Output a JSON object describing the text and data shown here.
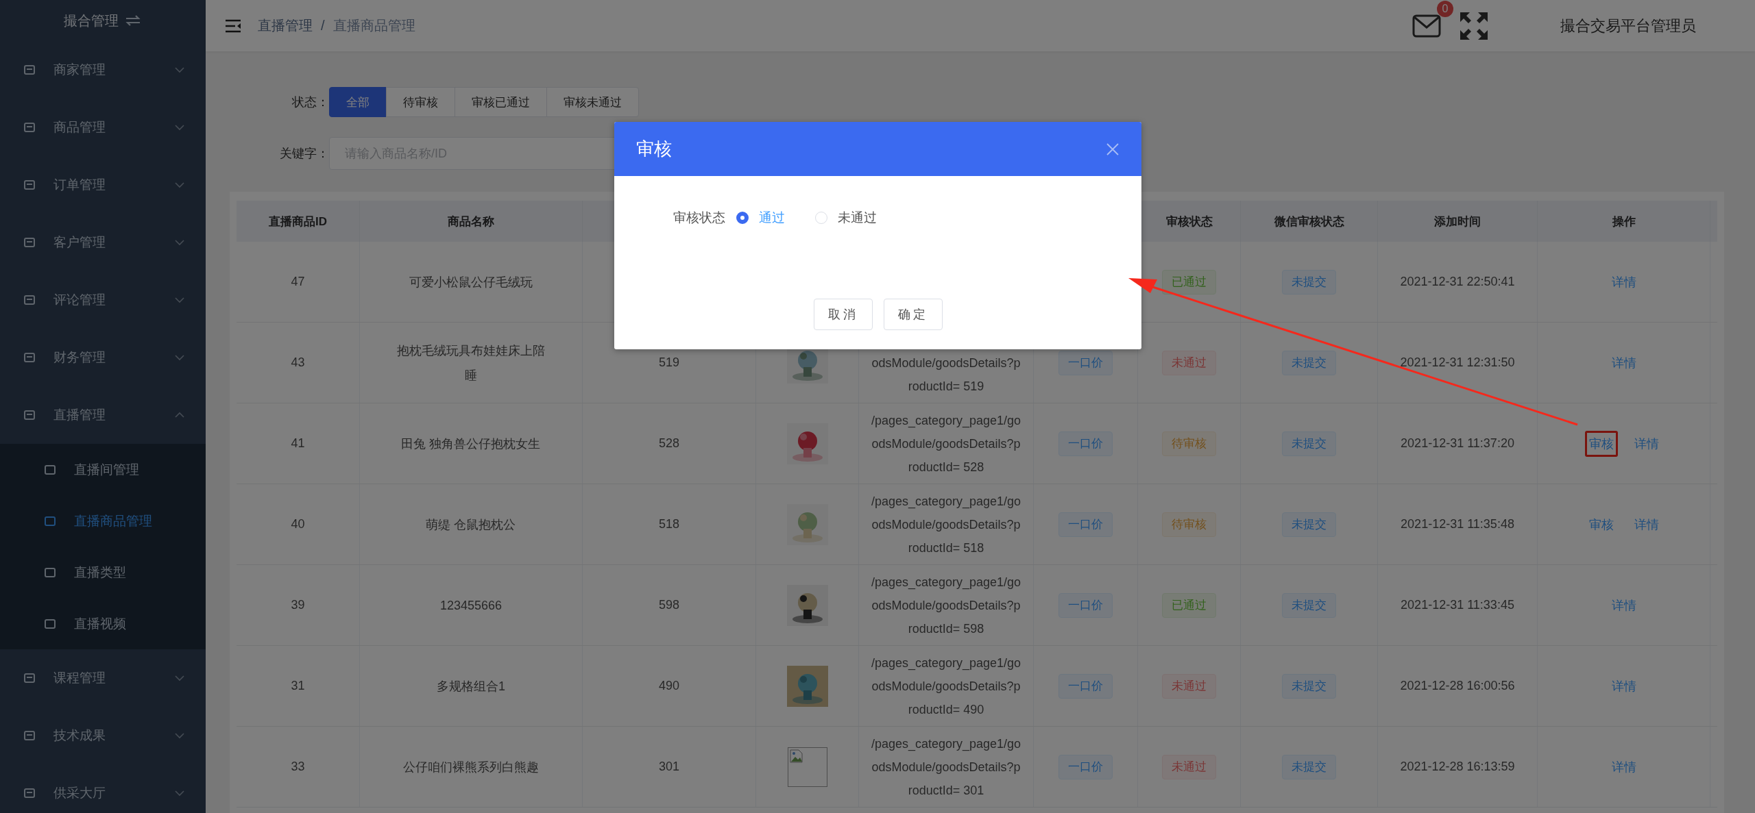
{
  "sidebar": {
    "title": "撮合管理",
    "menu": [
      {
        "label": "商家管理",
        "expanded": false
      },
      {
        "label": "商品管理",
        "expanded": false
      },
      {
        "label": "订单管理",
        "expanded": false
      },
      {
        "label": "客户管理",
        "expanded": false
      },
      {
        "label": "评论管理",
        "expanded": false
      },
      {
        "label": "财务管理",
        "expanded": false
      },
      {
        "label": "直播管理",
        "expanded": true,
        "children": [
          {
            "label": "直播间管理",
            "selected": false
          },
          {
            "label": "直播商品管理",
            "selected": true
          },
          {
            "label": "直播类型",
            "selected": false
          },
          {
            "label": "直播视频",
            "selected": false
          }
        ]
      },
      {
        "label": "课程管理",
        "expanded": false
      },
      {
        "label": "技术成果",
        "expanded": false
      },
      {
        "label": "供采大厅",
        "expanded": false
      }
    ]
  },
  "header": {
    "breadcrumb": [
      "直播管理",
      "直播商品管理"
    ],
    "breadcrumb_separator": "/",
    "mail_badge": "0",
    "user": "撮合交易平台管理员"
  },
  "filters": {
    "status_label": "状态：",
    "status_options": [
      {
        "label": "全部",
        "selected": true
      },
      {
        "label": "待审核",
        "selected": false
      },
      {
        "label": "审核已通过",
        "selected": false
      },
      {
        "label": "审核未通过",
        "selected": false
      }
    ],
    "keyword_label": "关键字：",
    "keyword_placeholder": "请输入商品名称/ID"
  },
  "table": {
    "columns": [
      "直播商品ID",
      "商品名称",
      null,
      null,
      null,
      null,
      "审核状态",
      "微信审核状态",
      "添加时间",
      "操作"
    ],
    "rows": [
      {
        "id": "47",
        "name": "可爱小松鼠公仔毛绒玩",
        "status": {
          "text": "已通过",
          "kind": "passed"
        },
        "wechat_status": "未提交",
        "added": "2021-12-31 22:50:41",
        "actions": [
          {
            "label": "详情",
            "annotated": false
          }
        ]
      },
      {
        "id": "43",
        "name": "抱枕毛绒玩具布娃娃床上陪睡",
        "column_3": "519",
        "image": {
          "kind": "picture"
        },
        "column_5": [
          "odsModule/goodsDetails?p",
          "roductId= 519"
        ],
        "column_6": "一口价",
        "status": {
          "text": "未通过",
          "kind": "rejected"
        },
        "wechat_status": "未提交",
        "added": "2021-12-31 12:31:50",
        "actions": [
          {
            "label": "详情",
            "annotated": false
          }
        ]
      },
      {
        "id": "41",
        "name": "田兔 独角兽公仔抱枕女生",
        "column_3": "528",
        "image": {
          "kind": "picture"
        },
        "column_5": [
          "/pages_category_page1/go",
          "odsModule/goodsDetails?p",
          "roductId= 528"
        ],
        "column_6": "一口价",
        "status": {
          "text": "待审核",
          "kind": "pending"
        },
        "wechat_status": "未提交",
        "added": "2021-12-31 11:37:20",
        "actions": [
          {
            "label": "审核",
            "annotated": true
          },
          {
            "label": "详情",
            "annotated": false
          }
        ]
      },
      {
        "id": "40",
        "name": "萌缇 仓鼠抱枕公",
        "column_3": "518",
        "image": {
          "kind": "picture"
        },
        "column_5": [
          "/pages_category_page1/go",
          "odsModule/goodsDetails?p",
          "roductId= 518"
        ],
        "column_6": "一口价",
        "status": {
          "text": "待审核",
          "kind": "pending"
        },
        "wechat_status": "未提交",
        "added": "2021-12-31 11:35:48",
        "actions": [
          {
            "label": "审核",
            "annotated": false
          },
          {
            "label": "详情",
            "annotated": false
          }
        ]
      },
      {
        "id": "39",
        "name": "123455666",
        "column_3": "598",
        "image": {
          "kind": "picture"
        },
        "column_5": [
          "/pages_category_page1/go",
          "odsModule/goodsDetails?p",
          "roductId= 598"
        ],
        "column_6": "一口价",
        "status": {
          "text": "已通过",
          "kind": "passed"
        },
        "wechat_status": "未提交",
        "added": "2021-12-31 11:33:45",
        "actions": [
          {
            "label": "详情",
            "annotated": false
          }
        ]
      },
      {
        "id": "31",
        "name": "多规格组合1",
        "column_3": "490",
        "image": {
          "kind": "picture"
        },
        "column_5": [
          "/pages_category_page1/go",
          "odsModule/goodsDetails?p",
          "roductId= 490"
        ],
        "column_6": "一口价",
        "status": {
          "text": "未通过",
          "kind": "rejected"
        },
        "wechat_status": "未提交",
        "added": "2021-12-28 16:00:56",
        "actions": [
          {
            "label": "详情",
            "annotated": false
          }
        ]
      },
      {
        "id": "33",
        "name": "公仔咱们裸熊系列白熊趣",
        "column_3": "301",
        "image": {
          "kind": "broken"
        },
        "column_5": [
          "/pages_category_page1/go",
          "odsModule/goodsDetails?p",
          "roductId= 301"
        ],
        "column_6": "一口价",
        "status": {
          "text": "未通过",
          "kind": "rejected"
        },
        "wechat_status": "未提交",
        "added": "2021-12-28 16:13:59",
        "actions": [
          {
            "label": "详情",
            "annotated": false
          }
        ]
      }
    ]
  },
  "dialog": {
    "title": "审核",
    "field_label": "审核状态",
    "options": [
      {
        "label": "通过",
        "selected": true
      },
      {
        "label": "未通过",
        "selected": false
      }
    ],
    "buttons": [
      "取消",
      "确定"
    ]
  }
}
